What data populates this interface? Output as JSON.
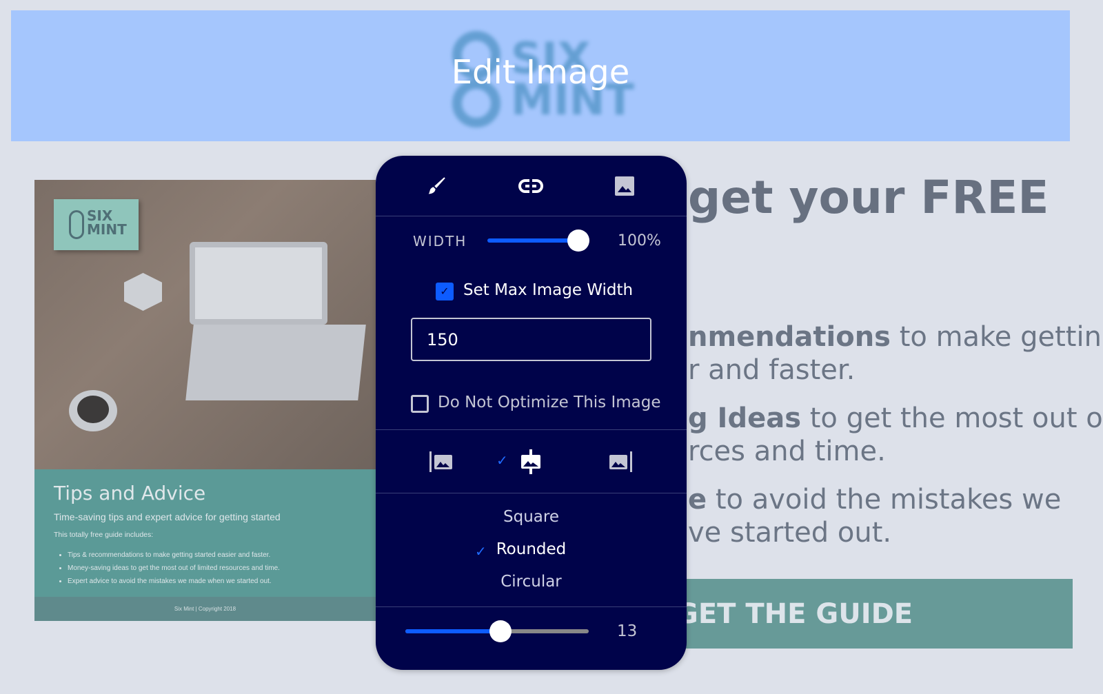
{
  "header": {
    "title": "Edit Image",
    "logo_text": "SIX MINT"
  },
  "cover": {
    "logo_line1": "SIX",
    "logo_line2": "MINT",
    "title": "Tips and Advice",
    "subtitle": "Time-saving tips and expert advice for getting started",
    "intro": "This totally free guide includes:",
    "bullets": [
      "Tips & recommendations to make getting started easier and faster.",
      "Money-saving ideas to get the most out of limited resources and time.",
      "Expert advice to avoid the mistakes we made when we started out."
    ],
    "footer": "Six Mint | Copyright 2018"
  },
  "page": {
    "headline": "get your FREE",
    "line1_bold": "nmendations",
    "line1_rest": " to make getting",
    "line2": "r and faster.",
    "line3_bold": "g Ideas",
    "line3_rest": " to get the most out of",
    "line4": "rces and time.",
    "line5_bold": "e",
    "line5_rest": " to avoid the mistakes we",
    "line6": "ve started out.",
    "cta": "GET THE GUIDE"
  },
  "panel": {
    "tabs": [
      {
        "icon": "paintbrush-icon"
      },
      {
        "icon": "link-icon"
      },
      {
        "icon": "image-icon"
      }
    ],
    "width_label": "WIDTH",
    "width_value": "100%",
    "width_percent": 100,
    "max_width_label": "Set Max Image Width",
    "max_width_checked": true,
    "max_width_value": "150",
    "no_optimize_label": "Do Not Optimize This Image",
    "no_optimize_checked": false,
    "alignment": {
      "options": [
        "left",
        "center",
        "right"
      ],
      "selected": "center"
    },
    "shapes": [
      "Square",
      "Rounded",
      "Circular"
    ],
    "selected_shape": "Rounded",
    "radius_value": "13",
    "radius_fraction": 0.52,
    "accent": "#0d5cff",
    "background": "#00034a"
  }
}
